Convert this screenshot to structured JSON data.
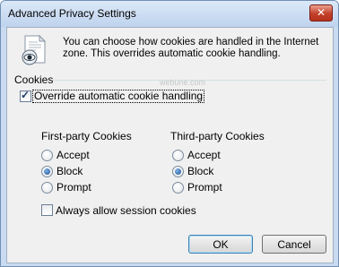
{
  "window": {
    "title": "Advanced Privacy Settings",
    "close_glyph": "✕"
  },
  "intro": "You can choose how cookies are handled in the Internet zone.  This overrides automatic cookie handling.",
  "cookies": {
    "group_label": "Cookies",
    "override": {
      "label": "Override automatic cookie handling",
      "checked": true
    },
    "first_party": {
      "title": "First-party Cookies",
      "options": [
        "Accept",
        "Block",
        "Prompt"
      ],
      "selected": "Block"
    },
    "third_party": {
      "title": "Third-party Cookies",
      "options": [
        "Accept",
        "Block",
        "Prompt"
      ],
      "selected": "Block"
    },
    "session": {
      "label": "Always allow session cookies",
      "checked": false
    }
  },
  "buttons": {
    "ok": "OK",
    "cancel": "Cancel"
  },
  "watermark": "webune.com",
  "icons": {
    "header": "privacy-document-eye-icon"
  }
}
